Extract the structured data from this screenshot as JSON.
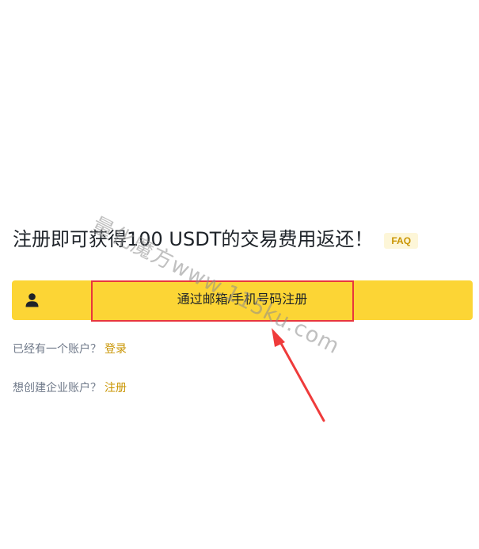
{
  "headline": {
    "text": "注册即可获得100 USDT的交易费用返还！",
    "faq_label": "FAQ"
  },
  "signup": {
    "button_label": "通过邮箱/手机号码注册",
    "icon": "user-icon"
  },
  "login_row": {
    "prompt": "已经有一个账户？",
    "link": "登录"
  },
  "enterprise_row": {
    "prompt": "想创建企业账户？",
    "link": "注册"
  },
  "watermark": {
    "text": "量化魔方www.115ku.com"
  },
  "colors": {
    "accent_yellow": "#fcd535",
    "link_gold": "#c99400",
    "highlight_red": "#e8363d",
    "text_primary": "#1e2329",
    "text_secondary": "#707a8a"
  }
}
